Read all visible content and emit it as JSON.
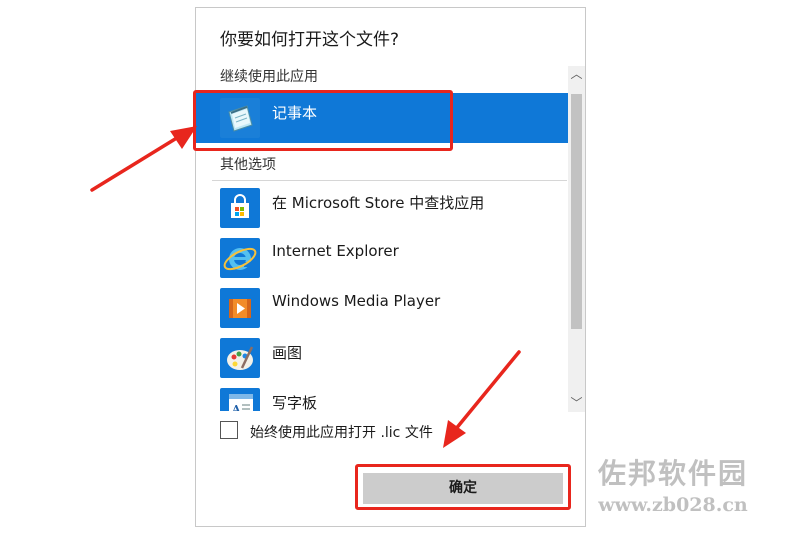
{
  "dialog": {
    "title": "你要如何打开这个文件?",
    "continue_section": "继续使用此应用",
    "other_section": "其他选项",
    "selected_app": {
      "label": "记事本",
      "icon": "notepad-icon"
    },
    "other_apps": [
      {
        "label": "在 Microsoft Store 中查找应用",
        "icon": "store-icon"
      },
      {
        "label": "Internet Explorer",
        "icon": "internet-explorer-icon"
      },
      {
        "label": "Windows Media Player",
        "icon": "media-player-icon"
      },
      {
        "label": "画图",
        "icon": "paint-icon"
      },
      {
        "label": "写字板",
        "icon": "wordpad-icon"
      }
    ],
    "always_use_label": "始终使用此应用打开 .lic 文件",
    "always_use_checked": false,
    "ok_label": "确定"
  },
  "watermark": {
    "name": "佐邦软件园",
    "url": "www.zb028.cn"
  },
  "colors": {
    "selection": "#0f78d7",
    "highlight": "#e8261d",
    "icon_tile": "#0f78d7"
  }
}
